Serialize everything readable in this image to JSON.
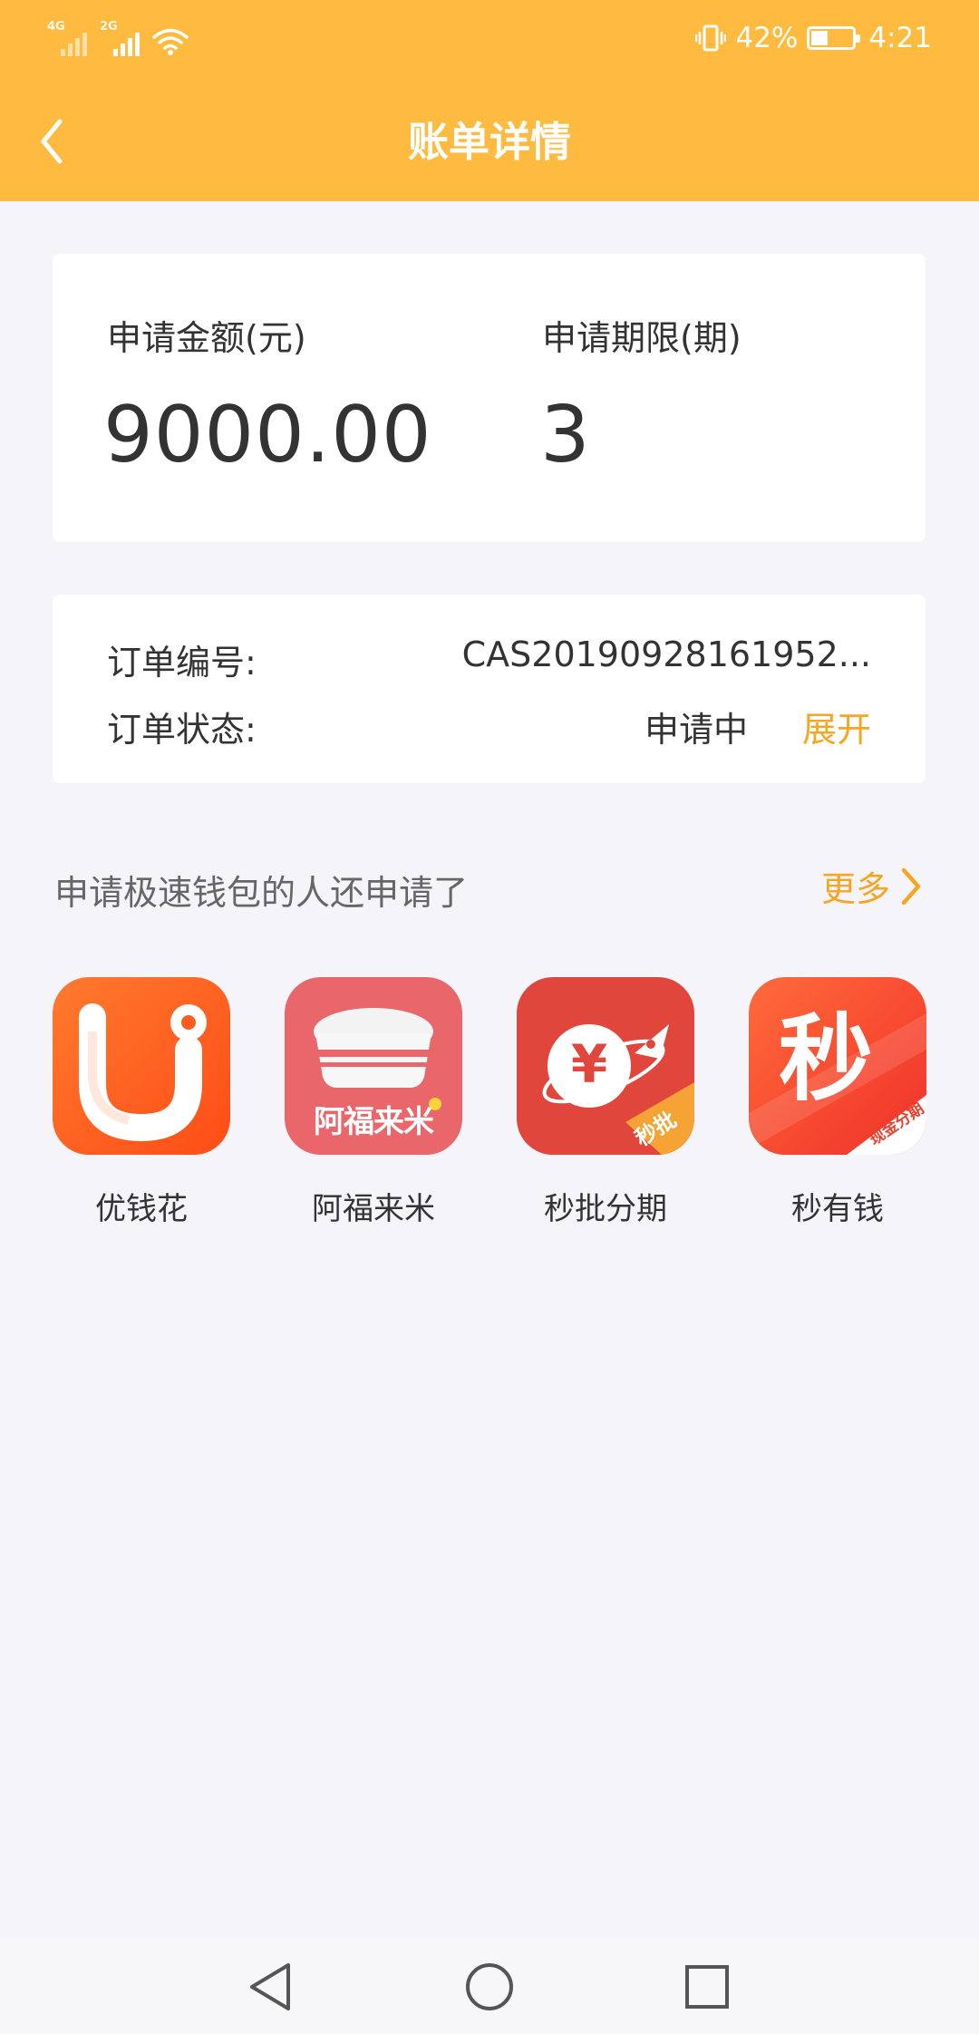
{
  "status_bar": {
    "network_1": "4G",
    "network_2": "2G",
    "battery_percent": "42%",
    "battery_level": 0.42,
    "time": "4:21"
  },
  "header": {
    "title": "账单详情",
    "color": "#ffbb3f"
  },
  "summary": {
    "amount_label": "申请金额(元)",
    "amount_value": "9000.00",
    "term_label": "申请期限(期)",
    "term_value": "3"
  },
  "order": {
    "number_label": "订单编号:",
    "number_value": "CAS20190928161952...",
    "status_label": "订单状态:",
    "status_value": "申请中",
    "expand_label": "展开"
  },
  "recommend": {
    "title": "申请极速钱包的人还申请了",
    "more_label": "更多",
    "apps": [
      {
        "name": "优钱花",
        "icon": "youqianhua-logo"
      },
      {
        "name": "阿福来米",
        "icon": "afulaimi-logo",
        "icon_text": "阿福来米"
      },
      {
        "name": "秒批分期",
        "icon": "miaopi-logo",
        "icon_symbol": "¥",
        "icon_badge": "秒批"
      },
      {
        "name": "秒有钱",
        "icon": "miaoyouqian-logo",
        "icon_text": "秒",
        "icon_badge": "现金分期"
      }
    ]
  },
  "colors": {
    "accent": "#f5a623",
    "background": "#f4f4f9"
  }
}
